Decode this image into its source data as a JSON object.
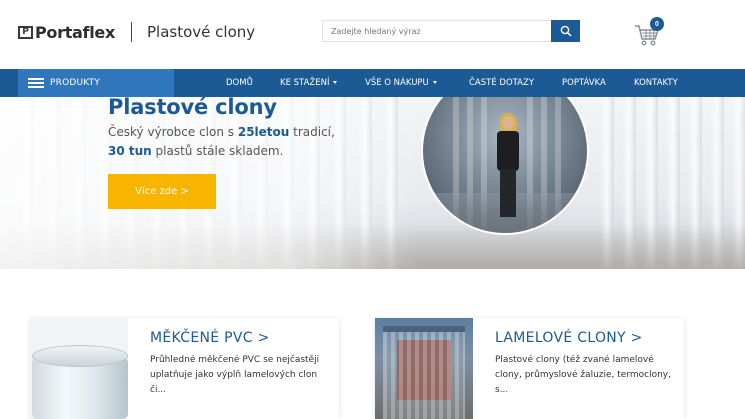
{
  "header": {
    "brand": "Portaflex",
    "brand_mark": "P",
    "site_title": "Plastové clony",
    "search": {
      "placeholder": "Zadejte hledaný výraz"
    },
    "cart": {
      "count": "0"
    }
  },
  "nav": {
    "products_label": "PRODUKTY",
    "items": [
      {
        "label": "DOMŮ",
        "has_dropdown": false
      },
      {
        "label": "KE STAŽENÍ",
        "has_dropdown": true
      },
      {
        "label": "VŠE O NÁKUPU",
        "has_dropdown": true
      },
      {
        "label": "ČASTÉ DOTAZY",
        "has_dropdown": false
      },
      {
        "label": "POPTÁVKA",
        "has_dropdown": false
      },
      {
        "label": "KONTAKTY",
        "has_dropdown": false
      }
    ]
  },
  "hero": {
    "title": "Plastové clony",
    "line1_pre": "Český výrobce clon s ",
    "line1_highlight": "25letou",
    "line1_post": " tradicí,",
    "line2_highlight": "30 tun",
    "line2_post": " plastů stále skladem.",
    "button_label": "Více zde >"
  },
  "cards": [
    {
      "title": "MĚKČENÉ PVC >",
      "text": "Průhledné měkčené PVC se nejčastěji uplatňuje jako výplň lamelových clon či..."
    },
    {
      "title": "LAMELOVÉ CLONY >",
      "text": "Plastové clony (též zvané lamelové clony, průmyslové žaluzie, termoclony, s..."
    }
  ],
  "colors": {
    "primary": "#1c5a96",
    "products_bg": "#2f76bd",
    "accent": "#f7b500"
  },
  "icons": {
    "search": "search-icon",
    "cart": "cart-icon",
    "menu": "hamburger-icon",
    "dropdown": "chevron-down-icon"
  }
}
